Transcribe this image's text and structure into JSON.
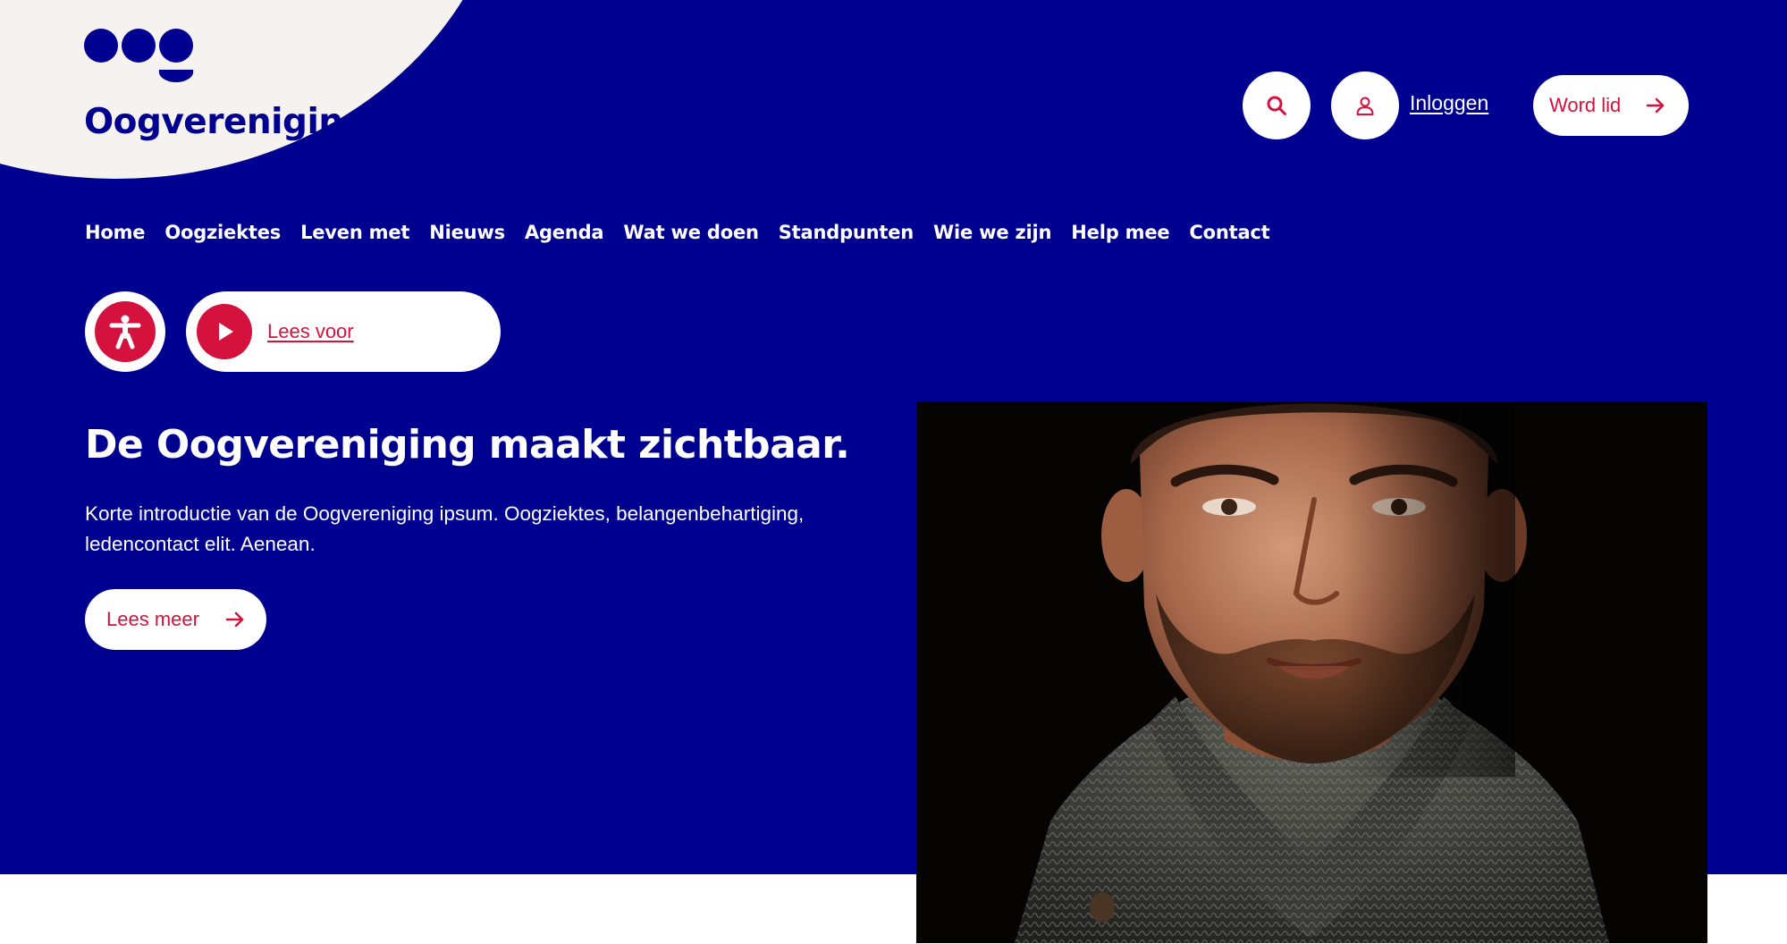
{
  "brand": {
    "name": "Oogvereniging",
    "colors": {
      "primary": "#000090",
      "accent": "#d5123e",
      "cream": "#f6f2ef",
      "white": "#ffffff"
    }
  },
  "header": {
    "search_icon": "search-icon",
    "user_icon": "user-icon",
    "login_label": "Inloggen",
    "join_label": "Word lid",
    "join_icon": "arrow-right-icon"
  },
  "nav": {
    "items": [
      {
        "label": "Home"
      },
      {
        "label": "Oogziektes"
      },
      {
        "label": "Leven met"
      },
      {
        "label": "Nieuws"
      },
      {
        "label": "Agenda"
      },
      {
        "label": "Wat we doen"
      },
      {
        "label": "Standpunten"
      },
      {
        "label": "Wie we zijn"
      },
      {
        "label": "Help mee"
      },
      {
        "label": "Contact"
      }
    ]
  },
  "accessibility": {
    "icon": "accessibility-icon",
    "read_aloud_icon": "play-icon",
    "read_aloud_label": "Lees voor"
  },
  "hero": {
    "title": "De Oogvereniging maakt zichtbaar.",
    "text": "Korte introductie van de Oogvereniging ipsum. Oogziektes, belangenbehartiging, ledencontact elit. Aenean.",
    "button_label": "Lees meer",
    "button_icon": "arrow-right-icon",
    "image_subject": "portrait of a bearded man in a knitted sweater"
  }
}
